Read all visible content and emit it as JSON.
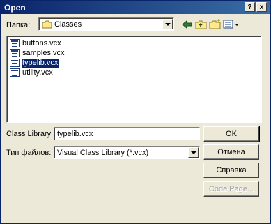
{
  "window": {
    "title": "Open",
    "help_label": "?",
    "close_label": "x"
  },
  "look_in": {
    "label": "Папка:",
    "value": "Classes"
  },
  "files": [
    {
      "name": "buttons.vcx",
      "selected": false
    },
    {
      "name": "samples.vcx",
      "selected": false
    },
    {
      "name": "typelib.vcx",
      "selected": true
    },
    {
      "name": "utility.vcx",
      "selected": false
    }
  ],
  "file_name": {
    "label": "Class Library",
    "value": "typelib.vcx"
  },
  "file_type": {
    "label": "Тип файлов:",
    "value": "Visual Class Library (*.vcx)"
  },
  "buttons": {
    "ok": "OK",
    "cancel": "Отмена",
    "help": "Справка",
    "code_page": "Code Page..."
  },
  "toolbar": {
    "back": "back-icon",
    "up": "up-folder-icon",
    "new_folder": "new-folder-icon",
    "view": "view-menu-icon"
  },
  "colors": {
    "titlebar_start": "#0A246A",
    "titlebar_end": "#3A6EA5",
    "selection": "#0A246A",
    "face": "#ECE9D8"
  }
}
